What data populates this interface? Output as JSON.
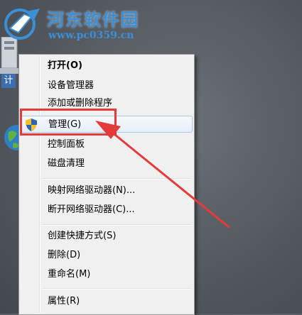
{
  "watermark": {
    "title": "河东软件园",
    "url": "www.pc0359.cn"
  },
  "desktop": {
    "icon_label_fragment": "计"
  },
  "context_menu": {
    "items": [
      {
        "label": "打开(O)",
        "bold": true
      },
      {
        "label": "设备管理器"
      },
      {
        "label": "添加或删除程序"
      },
      {
        "label": "管理(G)",
        "icon": "uac-shield-icon",
        "hovered": true
      },
      {
        "label": "控制面板"
      },
      {
        "label": "磁盘清理"
      },
      {
        "label": "映射网络驱动器(N)..."
      },
      {
        "label": "断开网络驱动器(C)..."
      },
      {
        "label": "创建快捷方式(S)"
      },
      {
        "label": "删除(D)"
      },
      {
        "label": "重命名(M)"
      },
      {
        "label": "属性(R)"
      }
    ]
  },
  "annotation": {
    "color": "#e53a3a",
    "target": "管理(G)"
  },
  "colors": {
    "menu_bg": "#f0f0f0",
    "hover_border": "#a8c8ec",
    "watermark": "#3b8fd6"
  }
}
